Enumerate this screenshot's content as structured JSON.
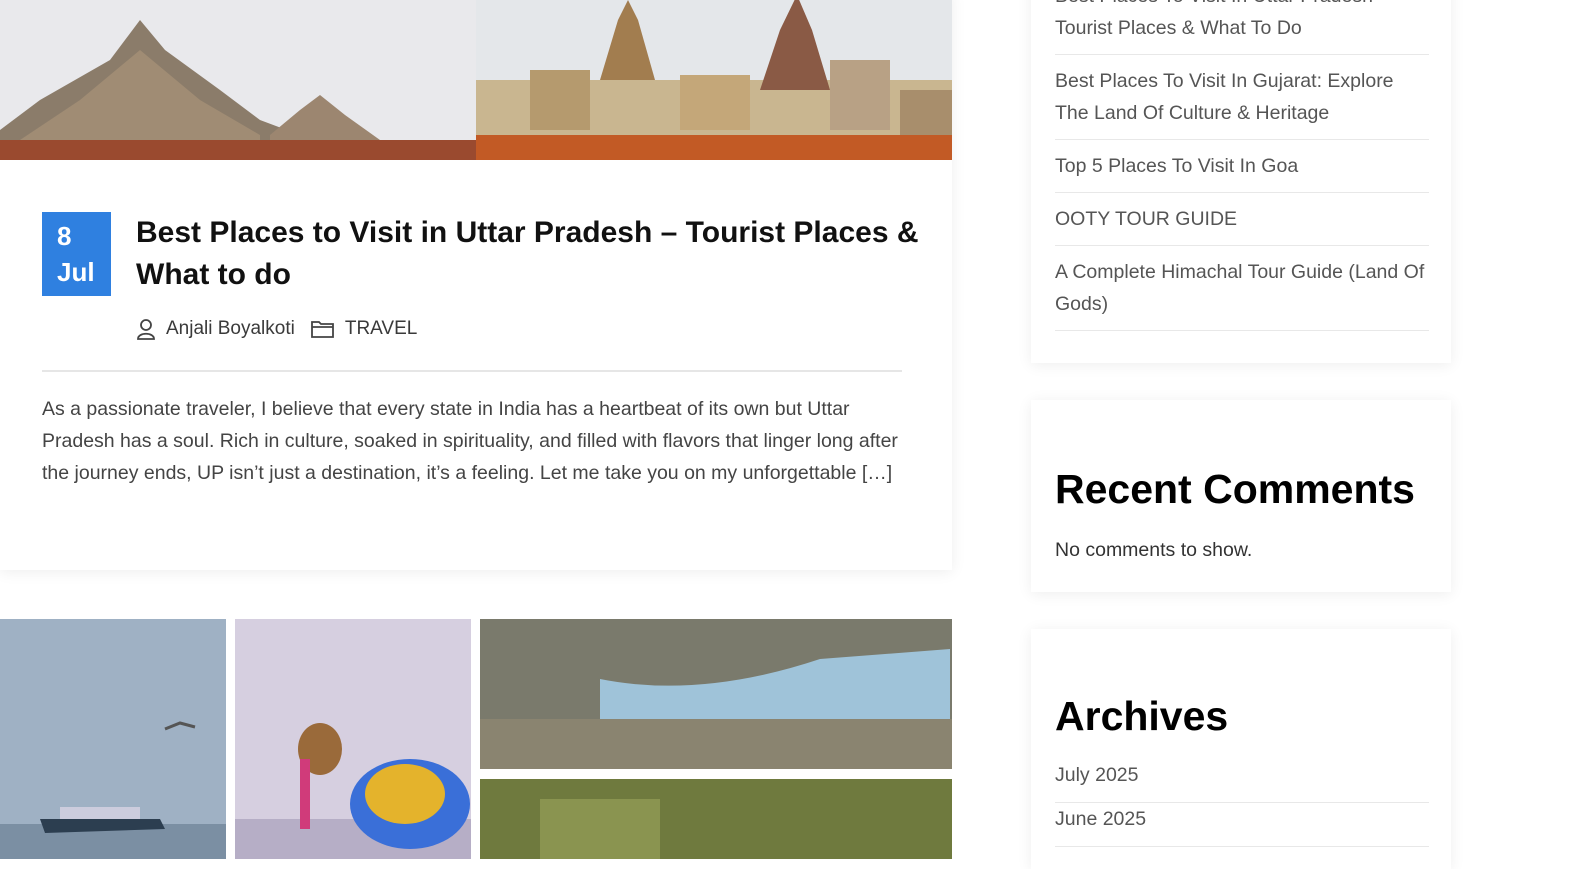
{
  "post": {
    "date_day": "8",
    "date_month": "Jul",
    "title": "Best Places to Visit in Uttar Pradesh – Tourist Places & What to do",
    "author": "Anjali Boyalkoti",
    "category": "TRAVEL",
    "excerpt": "As a passionate traveler, I believe that every state in India has a heartbeat of its own but Uttar Pradesh has a soul. Rich in culture, soaked in spirituality, and filled with flavors that linger long after the journey ends, UP isn’t just a destination, it’s a feeling. Let me take you on my unforgettable […]"
  },
  "sidebar": {
    "recent_posts": [
      "Best Places To Visit In Uttar Pradesh – Tourist Places & What To Do",
      "Best Places To Visit In Gujarat: Explore The Land Of Culture & Heritage",
      "Top 5 Places To Visit In Goa",
      "OOTY TOUR GUIDE",
      "A Complete Himachal Tour Guide (Land Of Gods)"
    ],
    "recent_comments_title": "Recent Comments",
    "recent_comments_empty": "No comments to show.",
    "archives_title": "Archives",
    "archives": [
      "July 2025",
      "June 2025"
    ]
  },
  "colors": {
    "accent": "#2f80e0",
    "title": "#111111",
    "text": "#444444"
  },
  "icons": {
    "author": "user-icon",
    "category": "folder-icon"
  }
}
